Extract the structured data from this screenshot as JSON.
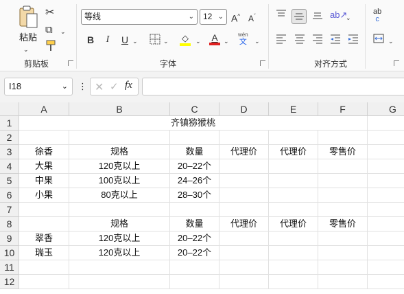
{
  "ribbon": {
    "clipboard": {
      "paste_label": "粘贴",
      "group_label": "剪贴板"
    },
    "font": {
      "group_label": "字体",
      "font_name": "等线",
      "font_size": "12",
      "bold": "B",
      "italic": "I",
      "underline": "U",
      "font_color_glyph": "A",
      "increase_glyph": "A",
      "decrease_glyph": "A",
      "phonetic_top": "wén",
      "phonetic_bottom": "文",
      "font_color_accent": "#e02020",
      "highlight_accent": "#ffff00"
    },
    "alignment": {
      "group_label": "对齐方式",
      "wrap_top": "ab",
      "wrap_bottom": "c"
    }
  },
  "formula_bar": {
    "name_box": "I18",
    "fx_label": "fx",
    "formula": ""
  },
  "sheet": {
    "columns": [
      "A",
      "B",
      "C",
      "D",
      "E",
      "F",
      "G"
    ],
    "rows": [
      "1",
      "2",
      "3",
      "4",
      "5",
      "6",
      "7",
      "8",
      "9",
      "10",
      "11",
      "12"
    ],
    "title": "齐镇猕猴桃",
    "cells": [
      [
        "",
        "",
        "",
        "",
        "",
        "",
        ""
      ],
      [
        "",
        "",
        "",
        "",
        "",
        "",
        ""
      ],
      [
        "徐香",
        "规格",
        "数量",
        "代理价",
        "代理价",
        "零售价",
        ""
      ],
      [
        "大果",
        "120克以上",
        "20–22个",
        "",
        "",
        "",
        ""
      ],
      [
        "中果",
        "100克以上",
        "24–26个",
        "",
        "",
        "",
        ""
      ],
      [
        "小果",
        "80克以上",
        "28–30个",
        "",
        "",
        "",
        ""
      ],
      [
        "",
        "",
        "",
        "",
        "",
        "",
        ""
      ],
      [
        "",
        "规格",
        "数量",
        "代理价",
        "代理价",
        "零售价",
        ""
      ],
      [
        "翠香",
        "120克以上",
        "20–22个",
        "",
        "",
        "",
        ""
      ],
      [
        "瑞玉",
        "120克以上",
        "20–22个",
        "",
        "",
        "",
        ""
      ],
      [
        "",
        "",
        "",
        "",
        "",
        "",
        ""
      ],
      [
        "",
        "",
        "",
        "",
        "",
        "",
        ""
      ]
    ]
  }
}
